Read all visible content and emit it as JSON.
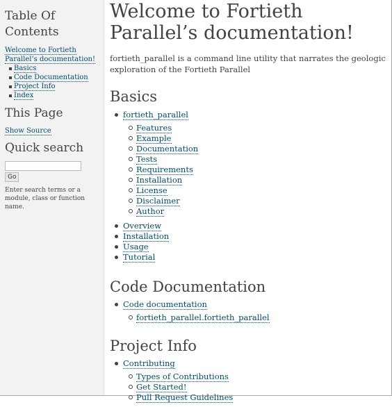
{
  "sidebar": {
    "toc_title": "Table Of Contents",
    "toc_root": "Welcome to Fortieth Parallel’s documentation!",
    "toc_items": [
      "Basics",
      "Code Documentation",
      "Project Info",
      "Index"
    ],
    "this_page_title": "This Page",
    "show_source": "Show Source",
    "quick_search_title": "Quick search",
    "search_button": "Go",
    "search_help": "Enter search terms or a module, class or function name."
  },
  "main": {
    "title": "Welcome to Fortieth Parallel’s documentation!",
    "intro": "fortieth_parallel is a command line utility that narrates the geologic exploration of the Fortieth Parallel",
    "sections": [
      {
        "heading": "Basics",
        "items": [
          {
            "label": "fortieth_parallel",
            "children": [
              "Features",
              "Example",
              "Documentation",
              "Tests",
              "Requirements",
              "Installation",
              "License",
              "Disclaimer",
              "Author"
            ]
          },
          {
            "label": "Overview",
            "children": []
          },
          {
            "label": "Installation",
            "children": []
          },
          {
            "label": "Usage",
            "children": []
          },
          {
            "label": "Tutorial",
            "children": []
          }
        ]
      },
      {
        "heading": "Code Documentation",
        "items": [
          {
            "label": "Code documentation",
            "children": [
              "fortieth_parallel.fortieth_parallel"
            ]
          }
        ]
      },
      {
        "heading": "Project Info",
        "items": [
          {
            "label": "Contributing",
            "children": [
              "Types of Contributions",
              "Get Started!",
              "Pull Request Guidelines"
            ]
          }
        ]
      }
    ]
  }
}
